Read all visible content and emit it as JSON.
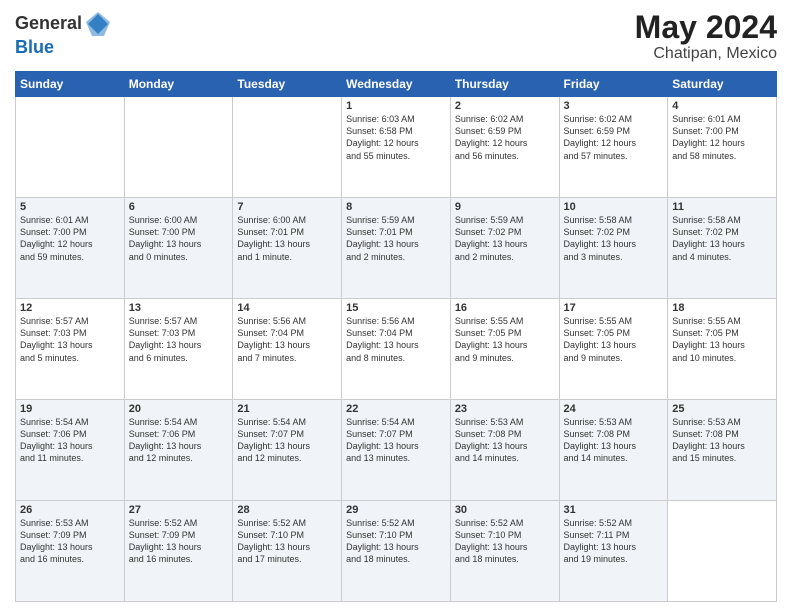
{
  "header": {
    "logo_line1": "General",
    "logo_line2": "Blue",
    "month_year": "May 2024",
    "location": "Chatipan, Mexico"
  },
  "days_of_week": [
    "Sunday",
    "Monday",
    "Tuesday",
    "Wednesday",
    "Thursday",
    "Friday",
    "Saturday"
  ],
  "rows": [
    [
      {
        "num": "",
        "info": ""
      },
      {
        "num": "",
        "info": ""
      },
      {
        "num": "",
        "info": ""
      },
      {
        "num": "1",
        "info": "Sunrise: 6:03 AM\nSunset: 6:58 PM\nDaylight: 12 hours\nand 55 minutes."
      },
      {
        "num": "2",
        "info": "Sunrise: 6:02 AM\nSunset: 6:59 PM\nDaylight: 12 hours\nand 56 minutes."
      },
      {
        "num": "3",
        "info": "Sunrise: 6:02 AM\nSunset: 6:59 PM\nDaylight: 12 hours\nand 57 minutes."
      },
      {
        "num": "4",
        "info": "Sunrise: 6:01 AM\nSunset: 7:00 PM\nDaylight: 12 hours\nand 58 minutes."
      }
    ],
    [
      {
        "num": "5",
        "info": "Sunrise: 6:01 AM\nSunset: 7:00 PM\nDaylight: 12 hours\nand 59 minutes."
      },
      {
        "num": "6",
        "info": "Sunrise: 6:00 AM\nSunset: 7:00 PM\nDaylight: 13 hours\nand 0 minutes."
      },
      {
        "num": "7",
        "info": "Sunrise: 6:00 AM\nSunset: 7:01 PM\nDaylight: 13 hours\nand 1 minute."
      },
      {
        "num": "8",
        "info": "Sunrise: 5:59 AM\nSunset: 7:01 PM\nDaylight: 13 hours\nand 2 minutes."
      },
      {
        "num": "9",
        "info": "Sunrise: 5:59 AM\nSunset: 7:02 PM\nDaylight: 13 hours\nand 2 minutes."
      },
      {
        "num": "10",
        "info": "Sunrise: 5:58 AM\nSunset: 7:02 PM\nDaylight: 13 hours\nand 3 minutes."
      },
      {
        "num": "11",
        "info": "Sunrise: 5:58 AM\nSunset: 7:02 PM\nDaylight: 13 hours\nand 4 minutes."
      }
    ],
    [
      {
        "num": "12",
        "info": "Sunrise: 5:57 AM\nSunset: 7:03 PM\nDaylight: 13 hours\nand 5 minutes."
      },
      {
        "num": "13",
        "info": "Sunrise: 5:57 AM\nSunset: 7:03 PM\nDaylight: 13 hours\nand 6 minutes."
      },
      {
        "num": "14",
        "info": "Sunrise: 5:56 AM\nSunset: 7:04 PM\nDaylight: 13 hours\nand 7 minutes."
      },
      {
        "num": "15",
        "info": "Sunrise: 5:56 AM\nSunset: 7:04 PM\nDaylight: 13 hours\nand 8 minutes."
      },
      {
        "num": "16",
        "info": "Sunrise: 5:55 AM\nSunset: 7:05 PM\nDaylight: 13 hours\nand 9 minutes."
      },
      {
        "num": "17",
        "info": "Sunrise: 5:55 AM\nSunset: 7:05 PM\nDaylight: 13 hours\nand 9 minutes."
      },
      {
        "num": "18",
        "info": "Sunrise: 5:55 AM\nSunset: 7:05 PM\nDaylight: 13 hours\nand 10 minutes."
      }
    ],
    [
      {
        "num": "19",
        "info": "Sunrise: 5:54 AM\nSunset: 7:06 PM\nDaylight: 13 hours\nand 11 minutes."
      },
      {
        "num": "20",
        "info": "Sunrise: 5:54 AM\nSunset: 7:06 PM\nDaylight: 13 hours\nand 12 minutes."
      },
      {
        "num": "21",
        "info": "Sunrise: 5:54 AM\nSunset: 7:07 PM\nDaylight: 13 hours\nand 12 minutes."
      },
      {
        "num": "22",
        "info": "Sunrise: 5:54 AM\nSunset: 7:07 PM\nDaylight: 13 hours\nand 13 minutes."
      },
      {
        "num": "23",
        "info": "Sunrise: 5:53 AM\nSunset: 7:08 PM\nDaylight: 13 hours\nand 14 minutes."
      },
      {
        "num": "24",
        "info": "Sunrise: 5:53 AM\nSunset: 7:08 PM\nDaylight: 13 hours\nand 14 minutes."
      },
      {
        "num": "25",
        "info": "Sunrise: 5:53 AM\nSunset: 7:08 PM\nDaylight: 13 hours\nand 15 minutes."
      }
    ],
    [
      {
        "num": "26",
        "info": "Sunrise: 5:53 AM\nSunset: 7:09 PM\nDaylight: 13 hours\nand 16 minutes."
      },
      {
        "num": "27",
        "info": "Sunrise: 5:52 AM\nSunset: 7:09 PM\nDaylight: 13 hours\nand 16 minutes."
      },
      {
        "num": "28",
        "info": "Sunrise: 5:52 AM\nSunset: 7:10 PM\nDaylight: 13 hours\nand 17 minutes."
      },
      {
        "num": "29",
        "info": "Sunrise: 5:52 AM\nSunset: 7:10 PM\nDaylight: 13 hours\nand 18 minutes."
      },
      {
        "num": "30",
        "info": "Sunrise: 5:52 AM\nSunset: 7:10 PM\nDaylight: 13 hours\nand 18 minutes."
      },
      {
        "num": "31",
        "info": "Sunrise: 5:52 AM\nSunset: 7:11 PM\nDaylight: 13 hours\nand 19 minutes."
      },
      {
        "num": "",
        "info": ""
      }
    ]
  ]
}
